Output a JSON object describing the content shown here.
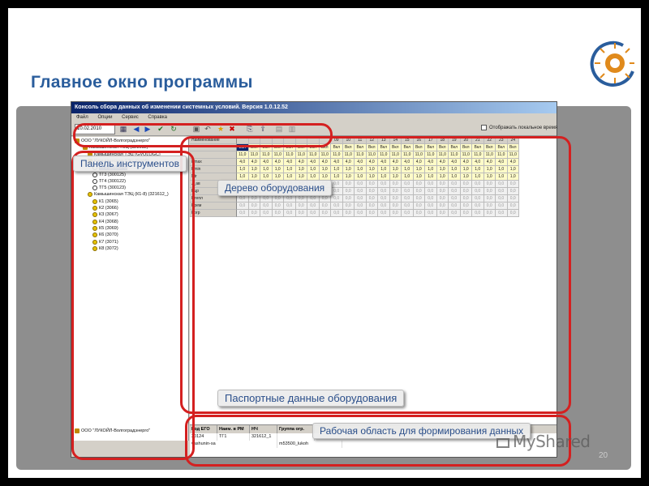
{
  "slide": {
    "title": "Главное окно программы",
    "page_number": "20",
    "watermark": "MyShared"
  },
  "app": {
    "window_title": "Консоль сбора данных об изменении системных условий. Версия 1.0.12.52",
    "menu": [
      "Файл",
      "Опции",
      "Сервис",
      "Справка"
    ],
    "date": "10.02.2010",
    "local_time_label": "Отображать локальное время",
    "tree": {
      "items": [
        {
          "label": "ООО \"ЛУКОЙЛ-Волгоградэнерго\"",
          "type": "plant"
        },
        {
          "label": "Камышинская ТЭЦ (321612)",
          "type": "plant"
        },
        {
          "label": "Камышинская ТЭЦ (GVOLOGC)",
          "type": "plant"
        },
        {
          "label": "Камышинская ТЭЦ (G105)",
          "type": "plant"
        },
        {
          "label": "ТГ3 (300124)",
          "type": "turbine",
          "selected": true
        },
        {
          "label": "ТГ3 (300125)",
          "type": "turbine"
        },
        {
          "label": "ТГ4 (300122)",
          "type": "turbine"
        },
        {
          "label": "ТГ5 (300123)",
          "type": "turbine"
        },
        {
          "label": "Камышинская ТЭЦ (К1-8) (321612_)",
          "type": "boiler"
        },
        {
          "label": "К1 (3065)",
          "type": "boiler"
        },
        {
          "label": "К2 (3066)",
          "type": "boiler"
        },
        {
          "label": "К3 (3067)",
          "type": "boiler"
        },
        {
          "label": "К4 (3068)",
          "type": "boiler"
        },
        {
          "label": "К5 (3069)",
          "type": "boiler"
        },
        {
          "label": "К6 (3070)",
          "type": "boiler"
        },
        {
          "label": "К7 (3071)",
          "type": "boiler"
        },
        {
          "label": "К8 (3072)",
          "type": "boiler"
        }
      ],
      "bottom_item": "ООО \"ЛУКОЙЛ-Волгоградэнерго\""
    },
    "grid": {
      "hours": [
        "09",
        "10",
        "11",
        "12",
        "13",
        "14",
        "15",
        "16",
        "17",
        "18",
        "19",
        "20",
        "21",
        "22",
        "23",
        "24"
      ],
      "first_col_label": "Наименование",
      "rows": [
        {
          "label": "",
          "fill": "Вкл",
          "style": "yellow"
        },
        {
          "label": "",
          "fill": "11,0",
          "style": "yellow"
        },
        {
          "label": "Pmax",
          "fill": "4,0",
          "style": "yellow"
        },
        {
          "label": "Pmin",
          "fill": "1,0",
          "style": "yellow"
        },
        {
          "label": "Ntr",
          "fill": "1,0",
          "style": "yellow"
        },
        {
          "label": "J_ав",
          "fill": "0,0",
          "style": "grey"
        },
        {
          "label": "Рцр",
          "fill": "0,0",
          "style": "grey"
        },
        {
          "label": "Ртепл",
          "fill": "0,0",
          "style": "grey"
        },
        {
          "label": "Ррем",
          "fill": "0,0",
          "style": "grey"
        },
        {
          "label": "Рогр",
          "fill": "0,0",
          "style": "grey"
        }
      ]
    },
    "bottom_table": {
      "headers": [
        "Код ЕГО",
        "Наим. в РМ",
        "НЧ",
        "Группа огр."
      ],
      "rows": [
        [
          "30124",
          "ТГ1",
          "321612_1",
          ""
        ],
        [
          "vashunin-sa",
          "",
          "",
          "m53500_lukoh"
        ]
      ]
    }
  },
  "callouts": {
    "toolbar": "Панель инструментов",
    "equipment_tree": "Дерево оборудования",
    "passport_data": "Паспортные данные оборудования",
    "work_area": "Рабочая область для формирования данных"
  },
  "colors": {
    "title": "#2a5d9c",
    "highlight": "#d42020",
    "callout_text": "#2a4e8a"
  }
}
